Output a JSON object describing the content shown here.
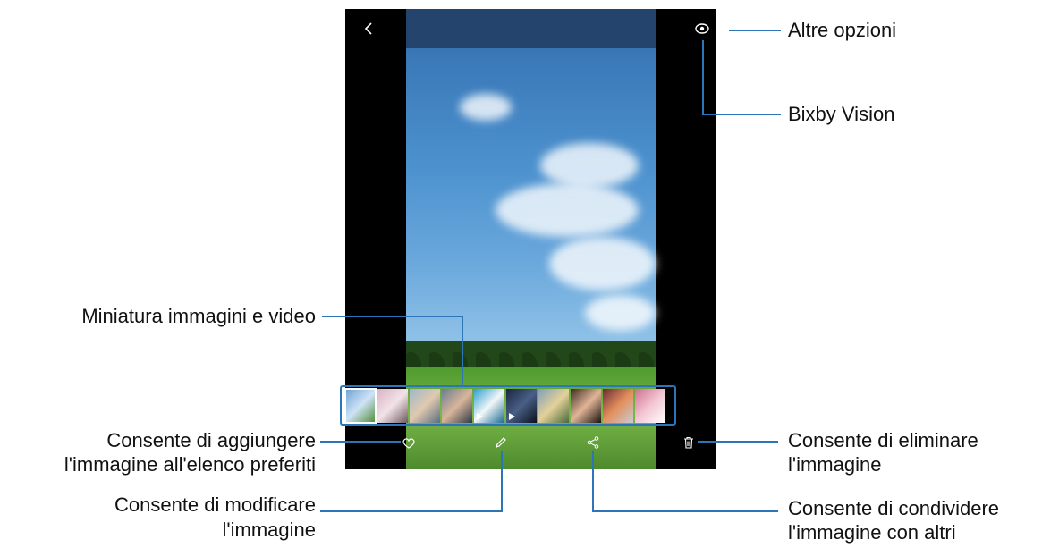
{
  "labels": {
    "more_options": "Altre opzioni",
    "bixby_vision": "Bixby Vision",
    "thumbnails": "Miniatura immagini e video",
    "favorite_line1": "Consente di aggiungere",
    "favorite_line2": "l'immagine all'elenco preferiti",
    "edit_line1": "Consente di modificare",
    "edit_line2": "l'immagine",
    "delete_line1": "Consente di eliminare",
    "delete_line2": "l'immagine",
    "share_line1": "Consente di condividere",
    "share_line2": "l'immagine con altri"
  },
  "icons": {
    "back": "back-icon",
    "bixby": "eye-icon",
    "more": "more-vertical-icon",
    "favorite": "heart-icon",
    "edit": "pencil-icon",
    "share": "share-icon",
    "delete": "trash-icon"
  },
  "colors": {
    "callout": "#2c76b8"
  },
  "thumbnails": [
    {
      "name": "thumb-sky",
      "colors": [
        "#6aa0d6",
        "#cfe3f4",
        "#4c8a35"
      ],
      "video": false,
      "selected": true
    },
    {
      "name": "thumb-girl",
      "colors": [
        "#d9b3c4",
        "#f2e2e8",
        "#6e5a60"
      ],
      "video": false
    },
    {
      "name": "thumb-kid",
      "colors": [
        "#9fb7c9",
        "#e0c9b0",
        "#5b6f7e"
      ],
      "video": false
    },
    {
      "name": "thumb-selfie",
      "colors": [
        "#6b7d92",
        "#d8b59a",
        "#2d3947"
      ],
      "video": false
    },
    {
      "name": "thumb-sea",
      "colors": [
        "#2e9fd0",
        "#f2f6f8",
        "#1b6c94"
      ],
      "video": true
    },
    {
      "name": "thumb-space",
      "colors": [
        "#1a2740",
        "#495f86",
        "#0c111c"
      ],
      "video": true
    },
    {
      "name": "thumb-dance",
      "colors": [
        "#7fa0b8",
        "#e4d19a",
        "#4a6a3a"
      ],
      "video": false
    },
    {
      "name": "thumb-portrait",
      "colors": [
        "#3e2a22",
        "#e0b597",
        "#1a130f"
      ],
      "video": false
    },
    {
      "name": "thumb-food",
      "colors": [
        "#6b2a35",
        "#e38f5c",
        "#c9cbd3"
      ],
      "video": false
    },
    {
      "name": "thumb-macaron",
      "colors": [
        "#cf6f90",
        "#f3c6d3",
        "#ffffff"
      ],
      "video": false
    }
  ]
}
